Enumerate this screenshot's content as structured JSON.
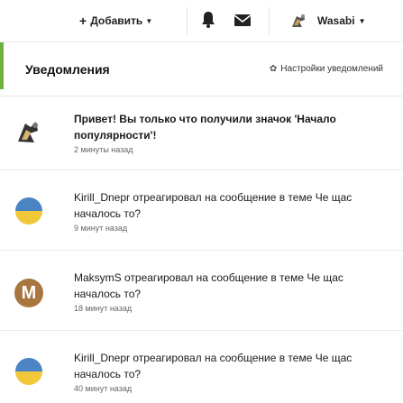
{
  "topbar": {
    "add_label": "Добавить",
    "user_name": "Wasabi"
  },
  "panel": {
    "title": "Уведомления",
    "settings_label": "Настройки уведомлений"
  },
  "notifications": [
    {
      "text": "Привет! Вы только что получили значок 'Начало популярности'!",
      "time": "2 минуты назад"
    },
    {
      "text": "Kirill_Dnepr отреагировал на сообщение в теме Че щас началось то?",
      "time": "9 минут назад"
    },
    {
      "text": "MaksymS отреагировал на сообщение в теме Че щас началось то?",
      "time": "18 минут назад",
      "avatar_letter": "M"
    },
    {
      "text": "Kirill_Dnepr отреагировал на сообщение в теме Че щас началось то?",
      "time": "40 минут назад"
    }
  ],
  "colors": {
    "accent": "#6cb33e",
    "avatar_m": "#a8763e",
    "flag_top": "#4a84c2",
    "flag_bottom": "#f2c83a"
  },
  "icons": [
    "plus-icon",
    "bell-icon",
    "envelope-icon",
    "gear-icon",
    "badge-icon"
  ]
}
